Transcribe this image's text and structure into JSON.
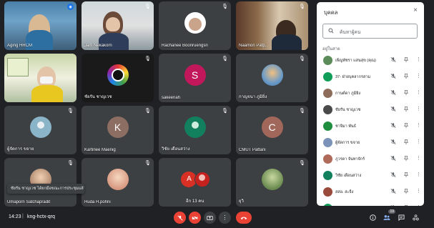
{
  "tiles": [
    {
      "name": "Aging HRCM",
      "mic": "◉"
    },
    {
      "name": "Jam Nekakorn",
      "mic": "🎙"
    },
    {
      "name": "Rachanee Boonruengsri",
      "mic": "🎙"
    },
    {
      "name": "Naamon Patp..",
      "mic": "🎙"
    },
    {
      "name": "",
      "mic": ""
    },
    {
      "name": "ชัยรัน ชาญเวช",
      "mic": "🎙"
    },
    {
      "name": "sakeenah",
      "initial": "S",
      "mic": "🎙"
    },
    {
      "name": "กาญจนา ภูมิยิ่ง",
      "mic": "🎙"
    },
    {
      "name": "ผู้จัดการ ขจาย",
      "mic": "🎙"
    },
    {
      "name": "Kartinee Maenig",
      "initial": "K",
      "mic": "🎙"
    },
    {
      "name": "วิชัย เดือนสว่าง",
      "mic": "🎙"
    },
    {
      "name": "CMUT Pattani",
      "initial": "C",
      "mic": "🎙"
    },
    {
      "name": "Umaporn Satchapradit",
      "mic": "🎙"
    },
    {
      "name": "Huda H.pohni",
      "mic": "🎙"
    },
    {
      "name": "อีก 13 คน",
      "initial": "A",
      "mic": ""
    },
    {
      "name": "ยุวิ",
      "mic": "🎙"
    }
  ],
  "toast": "ชัยรัน ชาญเวช ได้ยกมือขณะการประชุมแล้ว",
  "bottom": {
    "time": "14:23",
    "separator": "|",
    "meeting_code": "kng-hctx-qrq",
    "badge": "19"
  },
  "panel": {
    "title": "บุคคล",
    "close": "×",
    "search_placeholder": "ค้นหาผู้คน",
    "section": "อยู่ในสาย",
    "people": [
      {
        "name": "เพ็ญพัชรา แสนสุข (คุณ)",
        "color": "#5b8c5a"
      },
      {
        "name": "37- ฝ่ายบุคลากรสาม",
        "color": "#0f9d58"
      },
      {
        "name": "กานต์ดา ภูมิยิ่ง",
        "color": "#8e6c5a"
      },
      {
        "name": "ชัยรัน ชาญเวช",
        "color": "#4a4a4a"
      },
      {
        "name": "ชาจิมา พันธ์",
        "color": "#1e8e3e"
      },
      {
        "name": "ผู้จัดการ ขจาย",
        "color": "#7b93b8"
      },
      {
        "name": "ภูวรดา จันทาจักร์",
        "color": "#b06a5a"
      },
      {
        "name": "วิชัย เดือนสว่าง",
        "color": "#12805c"
      },
      {
        "name": "สสอ. สะจิ้ง",
        "color": "#9a4a3a"
      },
      {
        "name": "สสอ. ยะรัง",
        "color": "#0f9d58"
      }
    ]
  }
}
